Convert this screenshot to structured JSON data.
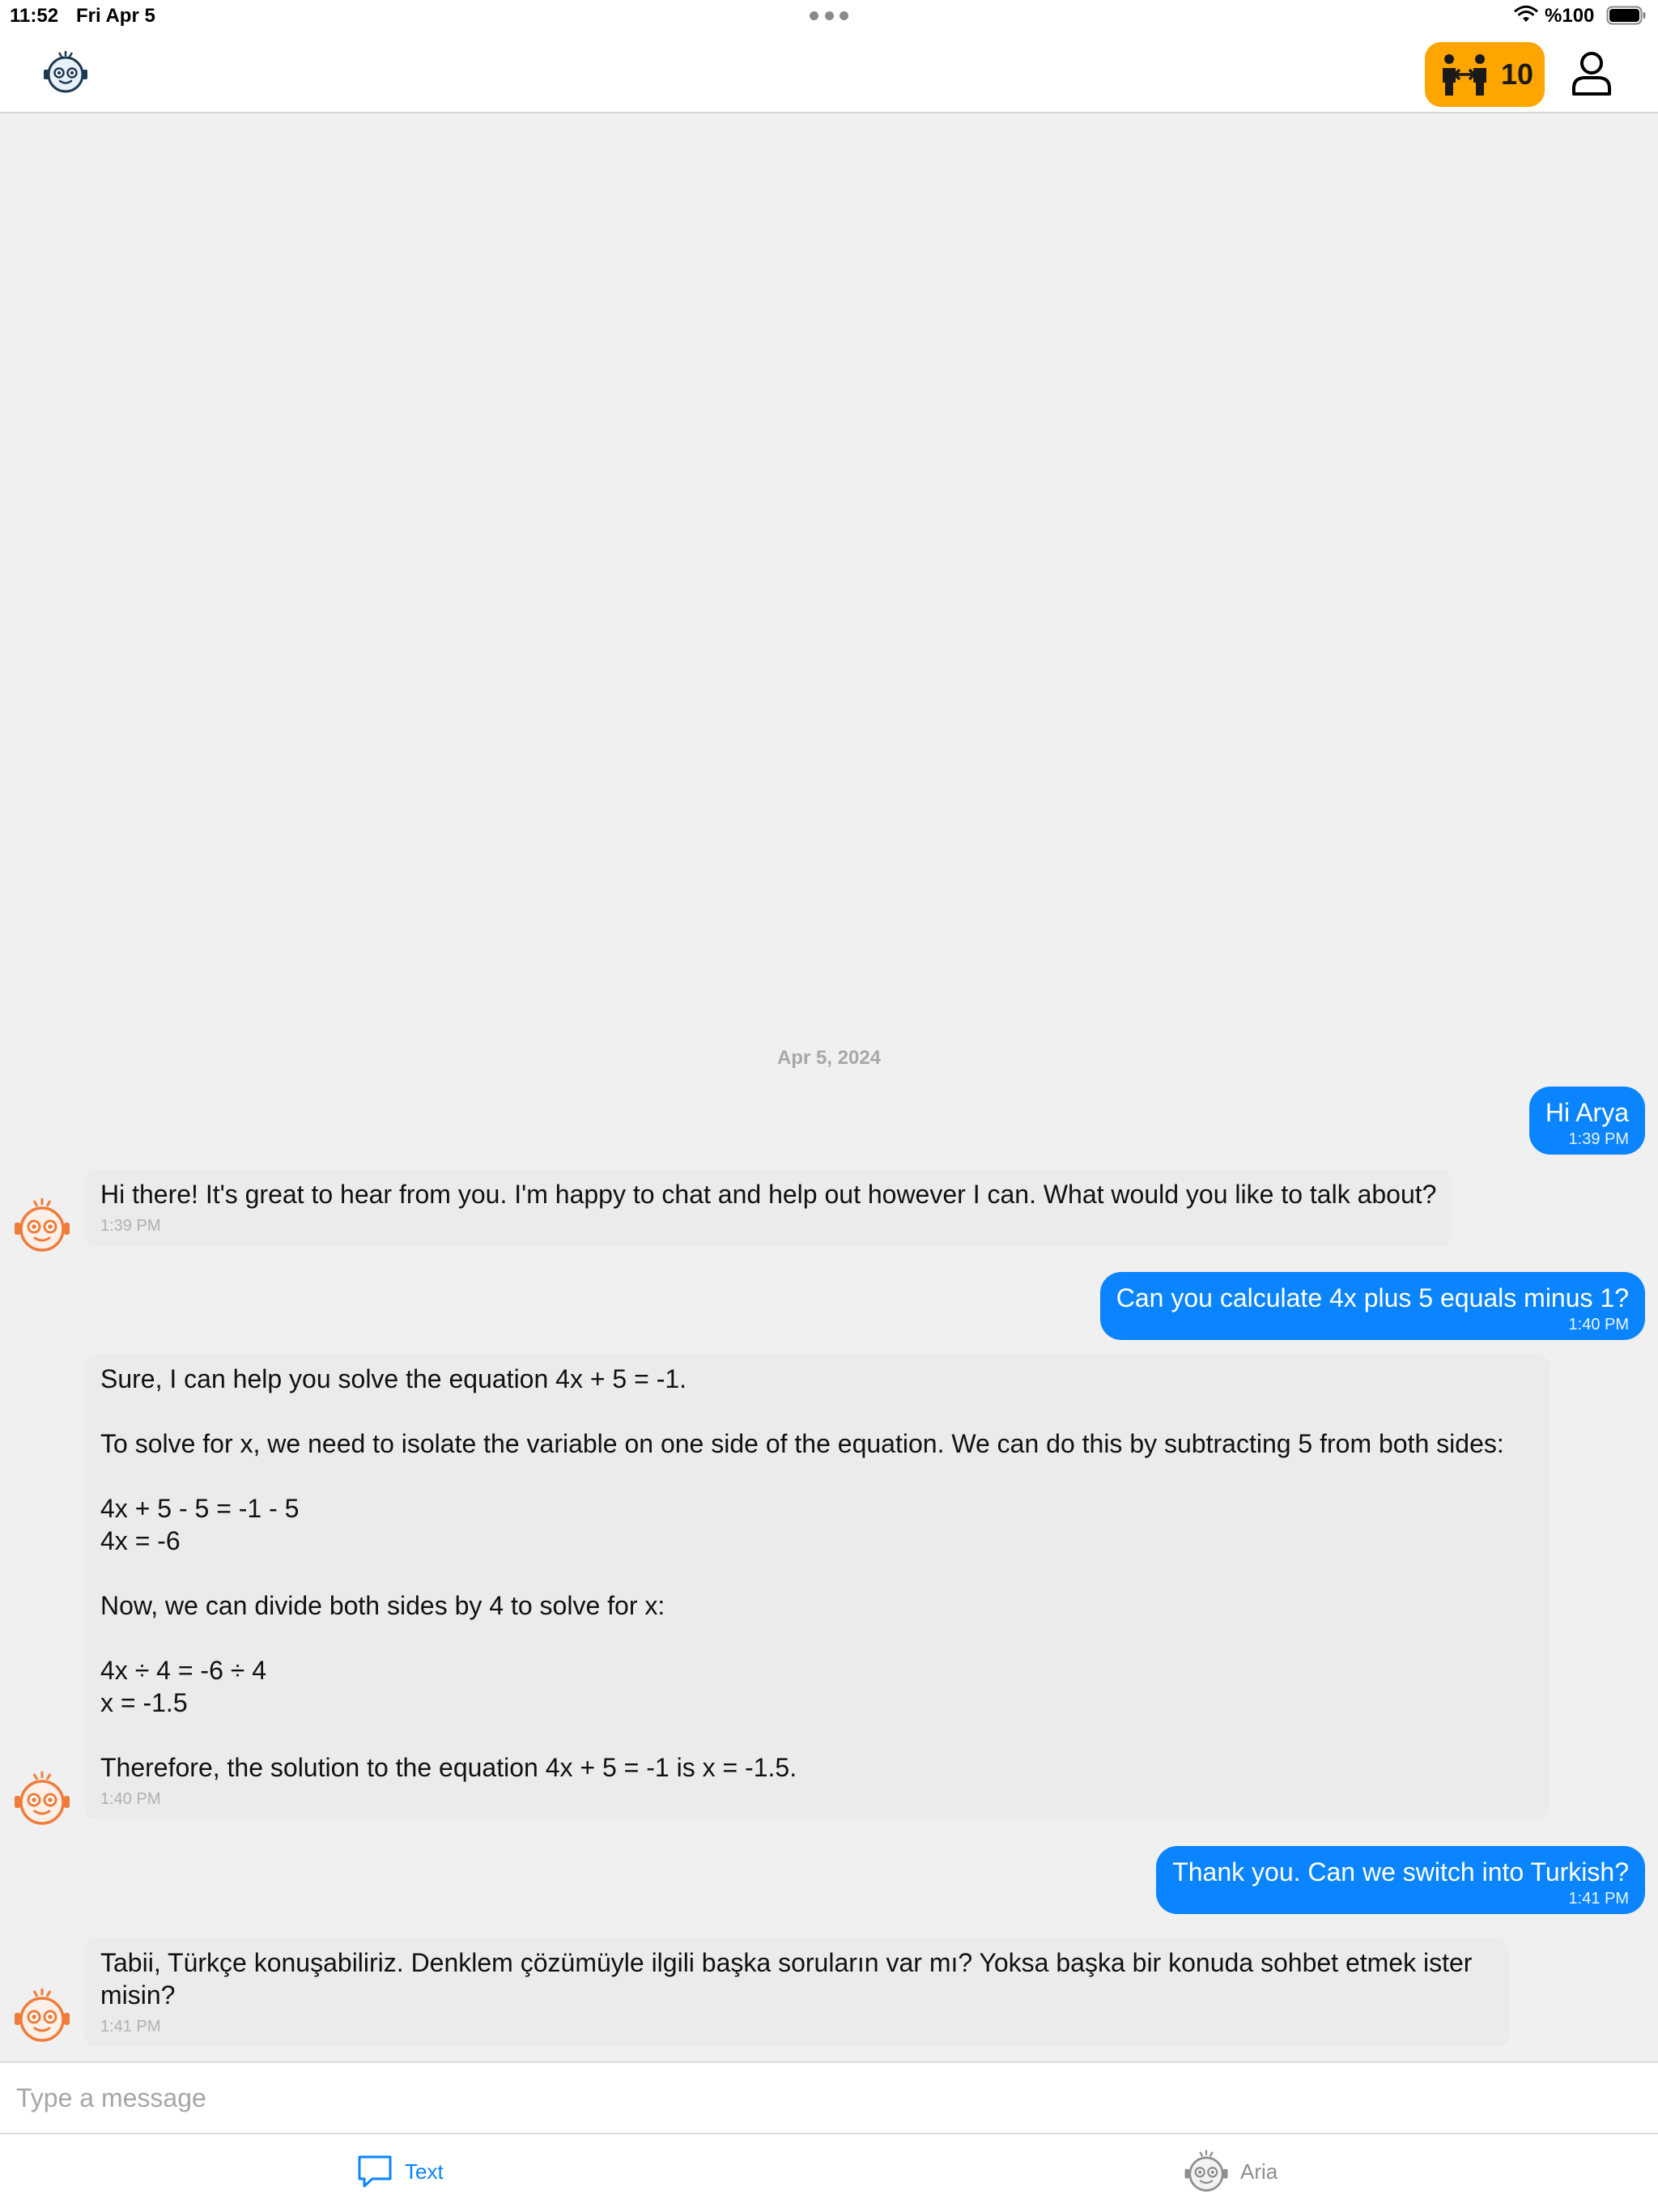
{
  "status_bar": {
    "time": "11:52",
    "date": "Fri Apr 5",
    "battery": "%100"
  },
  "header": {
    "credits_count": "10",
    "badge_color": "#ffa500"
  },
  "chat": {
    "date_divider": "Apr 5, 2024",
    "messages": [
      {
        "sender": "user",
        "text": "Hi Arya",
        "time": "1:39 PM"
      },
      {
        "sender": "bot",
        "text": "Hi there! It's great to hear from you. I'm happy to chat and help out however I can. What would you like to talk about?",
        "time": "1:39 PM"
      },
      {
        "sender": "user",
        "text": "Can you calculate 4x plus 5 equals minus 1?",
        "time": "1:40 PM"
      },
      {
        "sender": "bot",
        "text": "Sure, I can help you solve the equation 4x + 5 = -1.\n\nTo solve for x, we need to isolate the variable on one side of the equation. We can do this by subtracting 5 from both sides:\n\n4x + 5 - 5 = -1 - 5\n4x = -6\n\nNow, we can divide both sides by 4 to solve for x:\n\n4x ÷ 4 = -6 ÷ 4\nx = -1.5\n\nTherefore, the solution to the equation 4x + 5 = -1 is x = -1.5.",
        "time": "1:40 PM"
      },
      {
        "sender": "user",
        "text": "Thank you. Can we switch into Turkish?",
        "time": "1:41 PM"
      },
      {
        "sender": "bot",
        "text": "Tabii, Türkçe konuşabiliriz. Denklem çözümüyle ilgili başka soruların var mı? Yoksa başka bir konuda sohbet etmek ister\nmisin?",
        "time": "1:41 PM"
      }
    ]
  },
  "composer": {
    "placeholder": "Type a message",
    "value": ""
  },
  "tabs": [
    {
      "label": "Text",
      "icon": "chat-bubble-icon",
      "active": true
    },
    {
      "label": "Aria",
      "icon": "robot-icon",
      "active": false
    }
  ],
  "colors": {
    "user_bubble": "#0a84ff",
    "bot_bubble": "#ebebeb",
    "bot_accent": "#f07c3a",
    "active_tab": "#0a84ff"
  }
}
